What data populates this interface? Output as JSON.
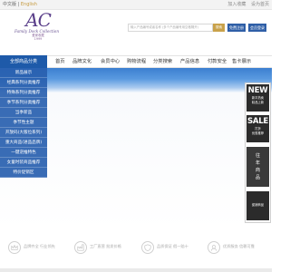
{
  "topbar": {
    "lang_cn": "中文版",
    "lang_sep": "|",
    "lang_en": "English",
    "links": [
      "加入收藏",
      "设为首页"
    ]
  },
  "logo": {
    "monogram": "AC",
    "script": "Family Dock Collection",
    "cn_lines": [
      "爱家收藏",
      "1999"
    ]
  },
  "search": {
    "placeholder": "输入产品编号或者名称 (多个产品编号用空格隔开)",
    "button": "搜索",
    "register": "免费注册",
    "login": "会员登录"
  },
  "nav": {
    "category_header": "全部商品分类",
    "items": [
      "首页",
      "品牌文化",
      "会员中心",
      "购物流程",
      "分类搜索",
      "产品信息",
      "付款安全",
      "售卡展示"
    ]
  },
  "category_menu": [
    "新品展示",
    "经典系列分类推荐",
    "特殊系列分类推荐",
    "季节系列分类推荐",
    "当季新品",
    "季节性主题",
    "开放码(大版位系列)",
    "重大商品(进品品牌)",
    "一键逆推特色",
    "女童时装商品推荐",
    "特价促销区"
  ],
  "side_cards": [
    {
      "big": "NEW",
      "lines": [
        "新平热卖",
        "精品上新"
      ]
    },
    {
      "big": "SALE",
      "lines": [
        "打折",
        "优惠推荐"
      ]
    },
    {
      "big": "",
      "lines": [
        "往",
        "年",
        "商",
        "品"
      ]
    },
    {
      "big": "",
      "lines": [
        "促销商品"
      ]
    }
  ],
  "features": [
    "品牌齐全 行业领先",
    "工厂直营 批发价格",
    "品质保证 假一赔十",
    "优质服务 信赖可靠"
  ],
  "colors": {
    "nav_blue": "#1e5aa9",
    "menu_blue": "#2860af",
    "gold": "#c9a24b",
    "logo_purple": "#5a3f8a"
  }
}
